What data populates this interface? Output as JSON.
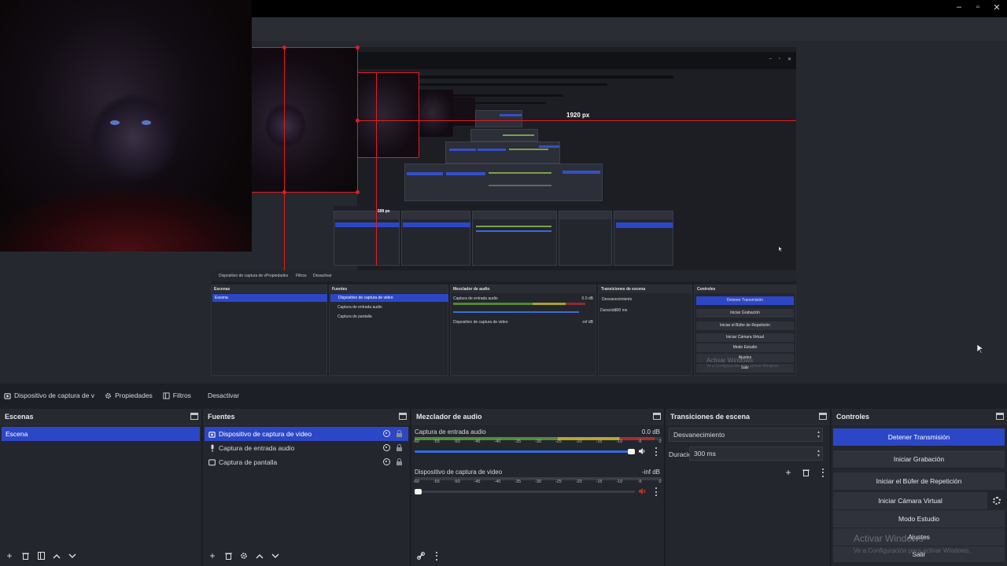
{
  "window_controls": [
    "–",
    "▫",
    "✕"
  ],
  "preview": {
    "measure_label_1": "1920 px",
    "measure_label_2": "599 px",
    "nested_toolbar": [
      "Dispositivo de captura de v",
      "Propiedades",
      "Filtros",
      "Desactivar"
    ],
    "nested_docks": [
      "Escenas",
      "Fuentes",
      "Mezclador de audio",
      "Transiciones de escena",
      "Controles"
    ],
    "nested_scene": "Escena",
    "nested_sources": [
      "Dispositivo de captura de video",
      "Captura de entrada audio",
      "Captura de pantalla"
    ],
    "nested_mixer": [
      "Captura de entrada audio",
      "Dispositivo de captura de video"
    ],
    "nested_mixer_db": [
      "0.0 dB",
      "-inf dB"
    ],
    "nested_transition": "Desvanecimiento",
    "nested_duration_label": "Duración",
    "nested_duration": "300 ms",
    "nested_controls": [
      "Detener Transmisión",
      "Iniciar Grabación",
      "Iniciar el Búfer de Repetición",
      "Iniciar Cámara Virtual",
      "Modo Estudio",
      "Ajustes",
      "Salir"
    ],
    "watermark_title": "Activar Windows",
    "watermark_sub": "Ve a Configuración para activar Windows."
  },
  "toolbar": {
    "source_name": "Dispositivo de captura de v",
    "properties": "Propiedades",
    "filters": "Filtros",
    "deactivate": "Desactivar"
  },
  "scenes": {
    "title": "Escenas",
    "items": [
      "Escena"
    ]
  },
  "sources": {
    "title": "Fuentes",
    "items": [
      {
        "label": "Dispositivo de captura de video",
        "icon": "camera-icon"
      },
      {
        "label": "Captura de entrada audio",
        "icon": "microphone-icon"
      },
      {
        "label": "Captura de pantalla",
        "icon": "monitor-icon"
      }
    ]
  },
  "mixer": {
    "title": "Mezclador de audio",
    "ticks": [
      "-60",
      "-55",
      "-50",
      "-45",
      "-40",
      "-35",
      "-30",
      "-25",
      "-20",
      "-15",
      "-10",
      "-5",
      "0"
    ],
    "channels": [
      {
        "name": "Captura de entrada audio",
        "db": "0.0 dB",
        "volume": 1.0,
        "level": 0.97
      },
      {
        "name": "Dispositivo de captura de video",
        "db": "-inf dB",
        "volume": 0.03,
        "level": 0.0
      }
    ]
  },
  "transitions": {
    "title": "Transiciones de escena",
    "selected": "Desvanecimiento",
    "duration_label": "Duración",
    "duration": "300 ms"
  },
  "controls": {
    "title": "Controles",
    "stop_stream": "Detener Transmisión",
    "start_recording": "Iniciar Grabación",
    "start_replay": "Iniciar el Búfer de Repetición",
    "start_virtual_cam": "Iniciar Cámara Virtual",
    "studio_mode": "Modo Estudio",
    "settings": "Ajustes",
    "exit": "Salir"
  },
  "watermark": {
    "title": "Activar Windows",
    "subtitle": "Ve a Configuración para activar Windows."
  },
  "colors": {
    "accent": "#2c47c6",
    "measure_red": "#e01c24",
    "dock_bg": "#24262d"
  }
}
